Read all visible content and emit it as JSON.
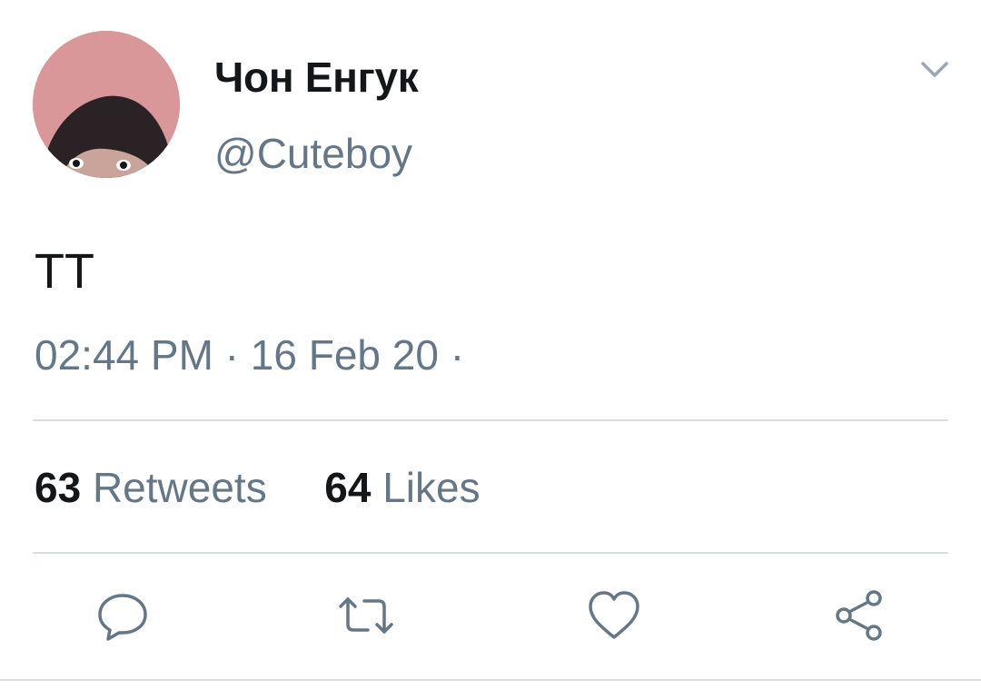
{
  "author": {
    "display_name": "Чон Енгук",
    "handle": "@Cuteboy"
  },
  "tweet": {
    "text": "TT",
    "timestamp": "02:44 PM · 16 Feb 20 ·"
  },
  "stats": {
    "retweets_count": "63",
    "retweets_label": "Retweets",
    "likes_count": "64",
    "likes_label": "Likes"
  },
  "actions": {
    "icons": [
      "reply-icon",
      "retweet-icon",
      "like-icon",
      "share-icon"
    ]
  },
  "colors": {
    "text_primary": "#14171a",
    "text_secondary": "#657786",
    "icon": "#657786",
    "divider": "#d6dde3"
  }
}
